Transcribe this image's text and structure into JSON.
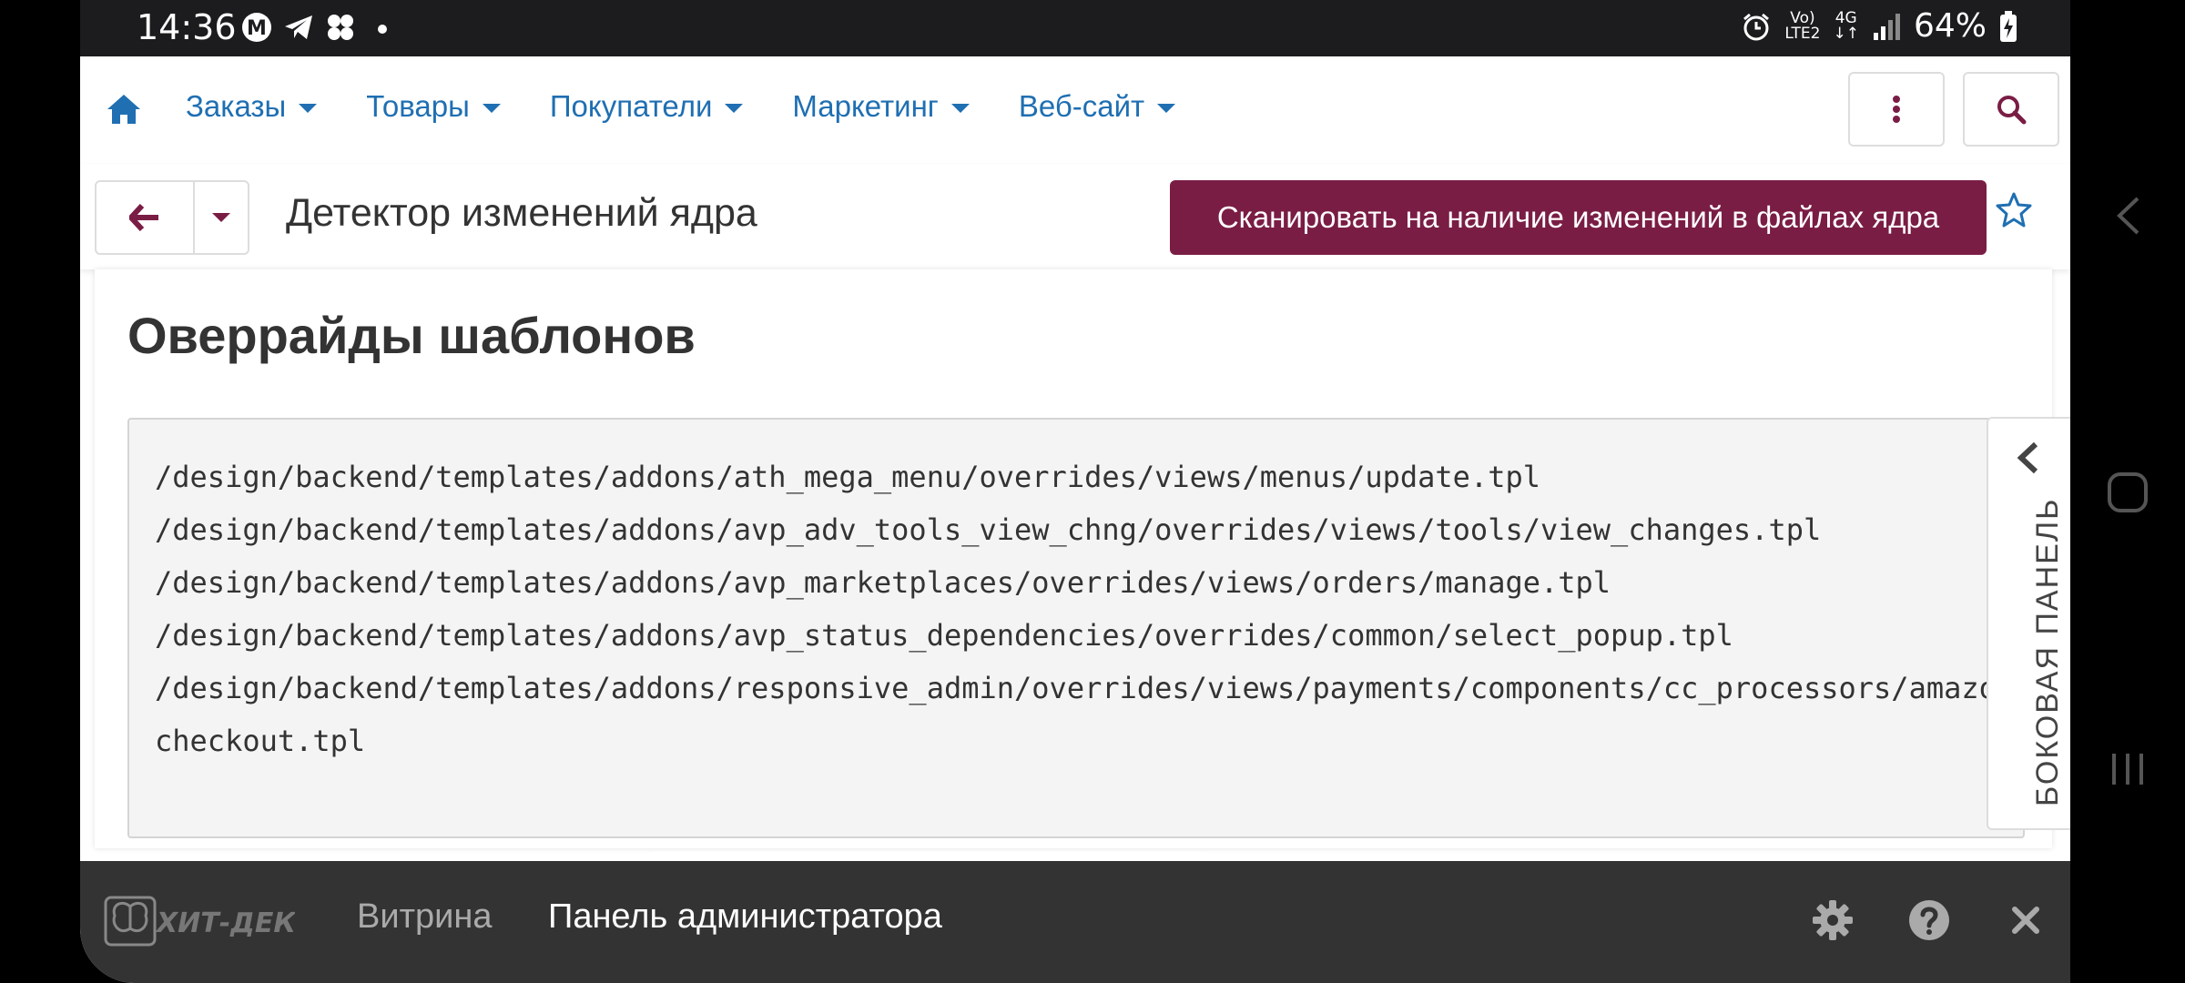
{
  "status_bar": {
    "time": "14:36",
    "signal_top": "Vo)",
    "signal_bottom": "LTE2",
    "network_top": "4G",
    "network_bottom": "↓↑",
    "battery": "64%"
  },
  "nav": {
    "items": [
      {
        "label": "Заказы"
      },
      {
        "label": "Товары"
      },
      {
        "label": "Покупатели"
      },
      {
        "label": "Маркетинг"
      },
      {
        "label": "Веб-сайт"
      }
    ]
  },
  "subheader": {
    "title": "Детектор изменений ядра",
    "scan_button": "Сканировать на наличие изменений в файлах ядра"
  },
  "content": {
    "section_title": "Оверрайды шаблонов",
    "paths": [
      "/design/backend/templates/addons/ath_mega_menu/overrides/views/menus/update.tpl",
      "/design/backend/templates/addons/avp_adv_tools_view_chng/overrides/views/tools/view_changes.tpl",
      "/design/backend/templates/addons/avp_marketplaces/overrides/views/orders/manage.tpl",
      "/design/backend/templates/addons/avp_status_dependencies/overrides/common/select_popup.tpl",
      "/design/backend/templates/addons/responsive_admin/overrides/views/payments/components/cc_processors/amazon_",
      "checkout.tpl"
    ]
  },
  "side_panel": {
    "label": "БОКОВАЯ ПАНЕЛЬ"
  },
  "bottom_bar": {
    "logo_text": "ХИТ-ДЕКОР",
    "storefront": "Витрина",
    "admin_panel": "Панель администратора"
  },
  "colors": {
    "link": "#1f6fb2",
    "brand": "#7a1d45",
    "bottom_bar": "#333333"
  }
}
